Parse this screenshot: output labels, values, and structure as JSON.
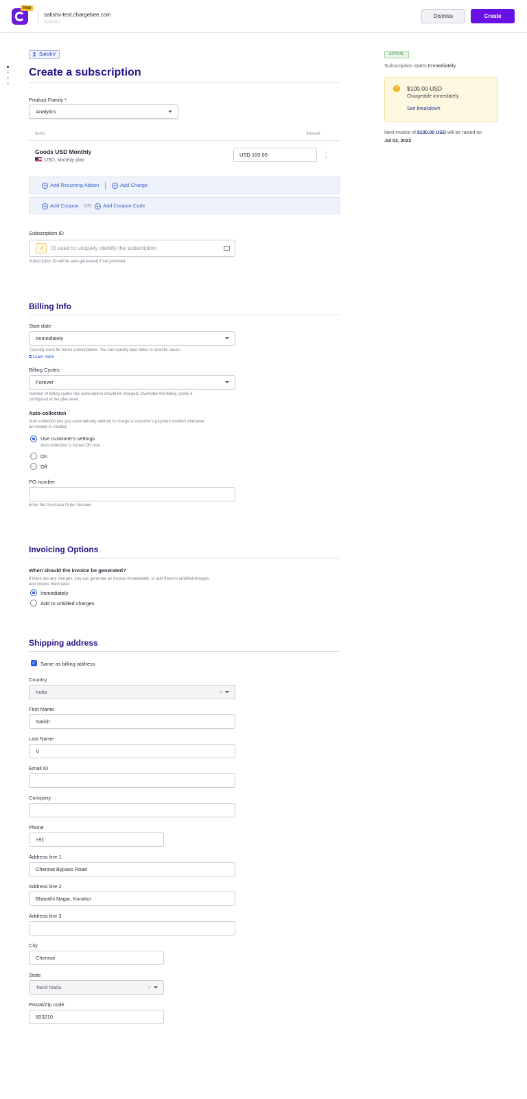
{
  "header": {
    "badge": "Test",
    "site": "satishv-test.chargebee.com",
    "site_sub": "SatishV",
    "dismiss": "Dismiss",
    "create": "Create"
  },
  "customer_chip": "SatishV",
  "title": "Create a subscription",
  "product_family": {
    "label": "Product Family *",
    "value": "Analytics"
  },
  "items_table": {
    "col_items": "Items",
    "col_amount": "Amount",
    "rows": [
      {
        "name": "Goods USD Monthly",
        "sub": "USD, Monthly plan",
        "amount": "USD  100.00"
      }
    ]
  },
  "actions": {
    "add_recurring_addon": "Add Recurring Addon",
    "add_charge": "Add Charge",
    "add_coupon": "Add Coupon",
    "or": "OR",
    "add_coupon_code": "Add Coupon Code"
  },
  "subscription_id": {
    "label": "Subscription ID",
    "placeholder": "ID used to uniquely identify the subscription",
    "help": "Subscription ID will be auto generated if not provided."
  },
  "billing": {
    "heading": "Billing Info",
    "start_date_label": "Start date",
    "start_date_value": "Immediately",
    "start_date_help": "Typically used for future subscriptions. You can specify past dates in specific cases.",
    "learn_more": "Learn more",
    "cycles_label": "Billing Cycles",
    "cycles_value": "Forever",
    "cycles_help_1": "Number of billing cycles this subscription should be charged. Overrides the billing cycles if",
    "cycles_help_2": "configured at the plan level.",
    "auto_label": "Auto-collection",
    "auto_help_1": "Auto-collection lets you automatically attempt to charge a customer's payment method whenever",
    "auto_help_2": "an invoice is created.",
    "opt_customer": "Use customer's settings",
    "opt_customer_sub": "Auto collection is turned ON now",
    "opt_on": "On",
    "opt_off": "Off",
    "po_label": "PO number",
    "po_help": "Enter the Purchase Order Number"
  },
  "invoicing": {
    "heading": "Invoicing Options",
    "question": "When should the invoice be generated?",
    "help_1": "If there are any charges, you can generate an invoice immediately, or add them to unbilled charges",
    "help_2": "and invoice them later.",
    "opt_immediately": "Immediately",
    "opt_unbilled": "Add to unbilled charges"
  },
  "shipping": {
    "heading": "Shipping address",
    "same_as_billing": "Same as billing address",
    "country_label": "Country",
    "country": "India",
    "first_name_label": "First Name",
    "first_name": "Satish",
    "last_name_label": "Last Name",
    "last_name": "V",
    "email_label": "Email ID",
    "email": "",
    "company_label": "Company",
    "company": "",
    "phone_label": "Phone",
    "phone": "+91",
    "addr1_label": "Address line 1",
    "addr1": "Chennai Bypass Road",
    "addr2_label": "Address line 2",
    "addr2": "Bharathi Nagar, Korattur",
    "addr3_label": "Address line 3",
    "addr3": "",
    "city_label": "City",
    "city": "Chennai",
    "state_label": "State",
    "state": "Tamil Nadu",
    "zip_label": "Postal/Zip code",
    "zip": "603210"
  },
  "summary": {
    "status": "ACTIVE",
    "starts_prefix": "Subscription starts ",
    "starts_value": "Immediately",
    "amount": "$100.00 USD",
    "chargeable": "Chargeable immediately",
    "breakdown": "See breakdown",
    "next_prefix": "Next invoice of ",
    "next_amount": "$100.00 USD",
    "next_mid": " will be raised on ",
    "next_date": "Jul 02, 2022"
  },
  "colors": {
    "brand": "#6a10e6",
    "heading": "#2a0f86",
    "link": "#2b5be0",
    "warning": "#f1b516"
  }
}
